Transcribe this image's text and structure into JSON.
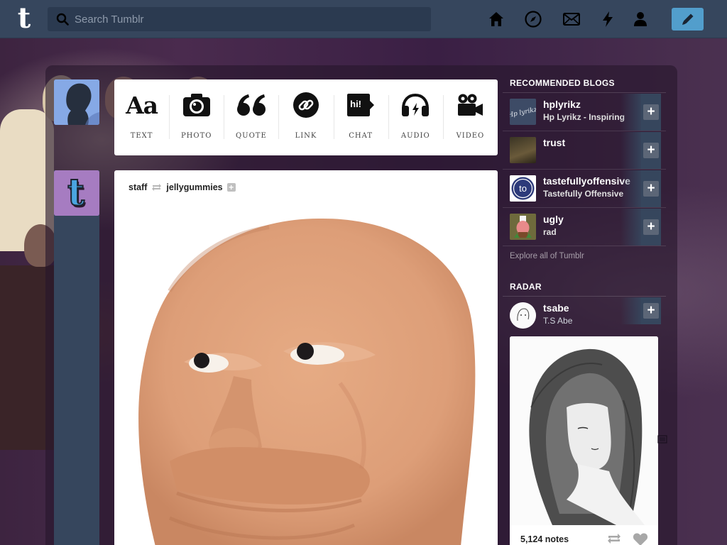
{
  "header": {
    "logo_letter": "t",
    "search_placeholder": "Search Tumblr"
  },
  "post_types": [
    {
      "label": "TEXT",
      "icon": "text-icon"
    },
    {
      "label": "PHOTO",
      "icon": "camera-icon"
    },
    {
      "label": "QUOTE",
      "icon": "quote-icon"
    },
    {
      "label": "LINK",
      "icon": "link-icon"
    },
    {
      "label": "CHAT",
      "icon": "chat-icon"
    },
    {
      "label": "AUDIO",
      "icon": "headphones-icon"
    },
    {
      "label": "VIDEO",
      "icon": "video-camera-icon"
    }
  ],
  "text_icon_glyph": "Aa",
  "chat_icon_glyph": "hi!",
  "post": {
    "author": "staff",
    "reblogged_from": "jellygummies",
    "follow_symbol": "+"
  },
  "sidebar": {
    "recommended_title": "RECOMMENDED BLOGS",
    "blogs": [
      {
        "name": "hplyrikz",
        "title": "Hp Lyrikz - Inspiring"
      },
      {
        "name": "trust",
        "title": ""
      },
      {
        "name": "tastefullyoffensive",
        "title": "Tastefully Offensive"
      },
      {
        "name": "ugly",
        "title": "rad"
      }
    ],
    "follow_symbol": "+",
    "explore_link": "Explore all of Tumblr",
    "radar_title": "RADAR",
    "radar": {
      "name": "tsabe",
      "title": "T.S Abe",
      "notes": "5,124 notes"
    },
    "tasteful_logo_text": "to",
    "hplyrikz_logo_text": "Hp lyrikz"
  },
  "colors": {
    "header_bg": "#36465d",
    "compose_accent": "#529ecc",
    "panel_bg": "#36465d"
  }
}
